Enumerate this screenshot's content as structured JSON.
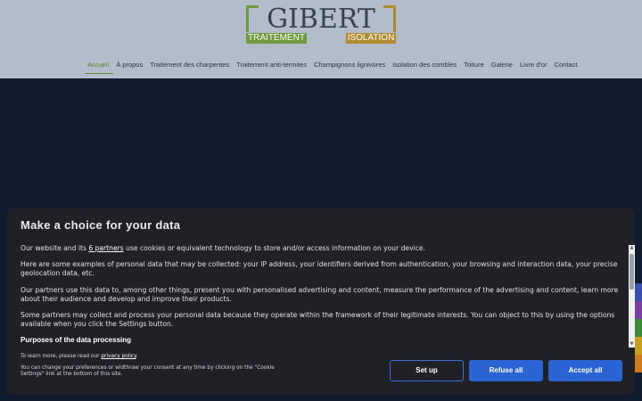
{
  "logo": {
    "main": "GIBERT",
    "left_bar": "TRAITEMENT",
    "right_bar": "ISOLATION"
  },
  "nav": {
    "items": [
      {
        "label": "Accueil",
        "active": true
      },
      {
        "label": "À propos"
      },
      {
        "label": "Traitement des charpentes"
      },
      {
        "label": "Traitement anti-termites"
      },
      {
        "label": "Champignons lignivores"
      },
      {
        "label": "Isolation des combles"
      },
      {
        "label": "Toiture"
      },
      {
        "label": "Galerie"
      },
      {
        "label": "Livre d'or"
      },
      {
        "label": "Contact"
      }
    ]
  },
  "side_tab_colors": [
    "#3a4fb0",
    "#7a3fa0",
    "#3a8a3a",
    "#c8a020",
    "#d07a20"
  ],
  "consent": {
    "title": "Make a choice for your data",
    "p1_pre": "Our website and its ",
    "p1_link": "6 partners",
    "p1_post": " use cookies or equivalent technology to store and/or access information on your device.",
    "p2": "Here are some examples of personal data that may be collected: your IP address, your identifiers derived from authentication, your browsing and interaction data, your precise geolocation data, etc.",
    "p3": "Our partners use this data to, among other things, present you with personalised advertising and content, measure the performance of the advertising and content, learn more about their audience and develop and improve their products.",
    "p4": "Some partners may collect and process your personal data because they operate within the framework of their legitimate interests. You can object to this by using the options available when you click the Settings button.",
    "purposes_heading": "Purposes of the data processing",
    "footer_pre": "To learn more, please read our ",
    "footer_link": "privacy policy",
    "footer_post": ".",
    "footer_p2": "You can change your preferences or widthraw your consent at any time by clicking on the \"Cookie Settings\" link at the bottom of this site.",
    "btn_setup": "Set up",
    "btn_refuse": "Refuse all",
    "btn_accept": "Accept all"
  }
}
